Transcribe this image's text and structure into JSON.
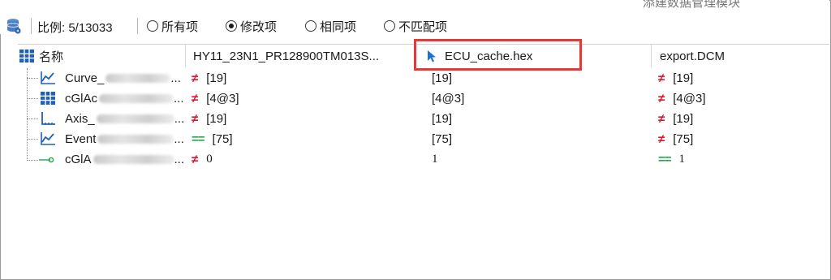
{
  "toolbar": {
    "ratio_label": "比例: 5/13033",
    "filters": [
      {
        "label": "所有项",
        "checked": false
      },
      {
        "label": "修改项",
        "checked": true
      },
      {
        "label": "相同项",
        "checked": false
      },
      {
        "label": "不匹配项",
        "checked": false
      }
    ],
    "top_right_text": "添建数据管理模块"
  },
  "columns": {
    "name": "名称",
    "file1": "HY11_23N1_PR128900TM013S...",
    "file2": "ECU_cache.hex",
    "file3": "export.DCM"
  },
  "rows": [
    {
      "name": "Curve_",
      "icon": "curve-icon",
      "v1": "[19]",
      "v1_status": "neq",
      "v2": "[19]",
      "v3": "[19]",
      "v3_status": "neq"
    },
    {
      "name": "cGlAc",
      "icon": "map-icon",
      "v1": "[4@3]",
      "v1_status": "neq",
      "v2": "[4@3]",
      "v3": "[4@3]",
      "v3_status": "neq"
    },
    {
      "name": "Axis_",
      "icon": "axis-icon",
      "v1": "[19]",
      "v1_status": "neq",
      "v2": "[19]",
      "v3": "[19]",
      "v3_status": "neq"
    },
    {
      "name": "Event",
      "icon": "curve-icon",
      "v1": "[75]",
      "v1_status": "eq",
      "v2": "[75]",
      "v3": "[75]",
      "v3_status": "neq"
    },
    {
      "name": "cGlA",
      "icon": "value-icon",
      "v1": "0",
      "v1_status": "neq",
      "v2": "1",
      "v3": "1",
      "v3_status": "eq"
    }
  ],
  "row_suffix": "...",
  "symbols": {
    "neq": "≠",
    "eq": "=="
  },
  "colors": {
    "neq": "#e0142a",
    "eq": "#21a84d",
    "icon_blue": "#1f5fbf",
    "highlight": "#e53935"
  }
}
